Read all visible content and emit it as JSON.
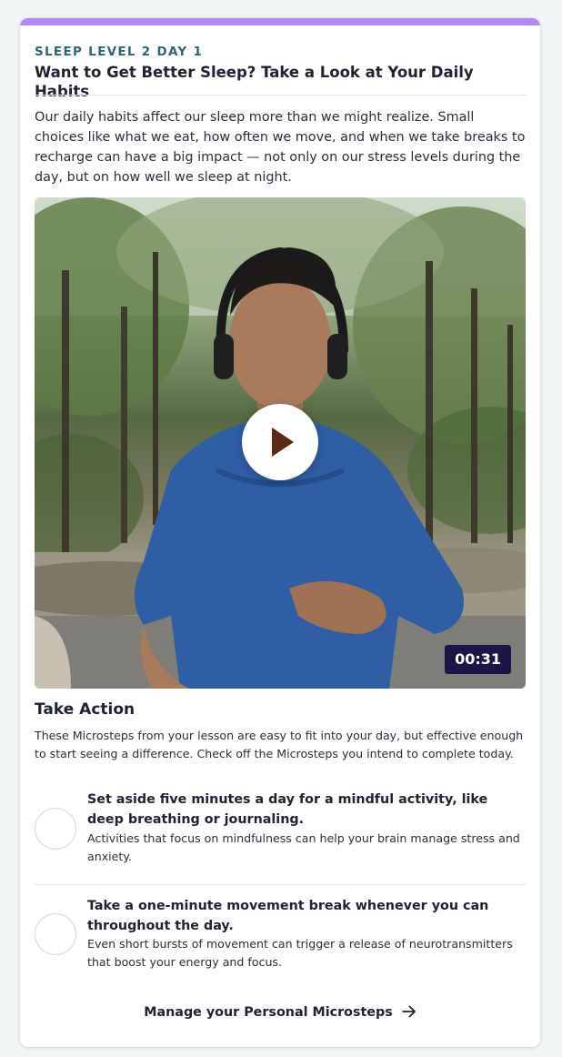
{
  "lesson": {
    "eyebrow": "SLEEP LEVEL 2 DAY 1",
    "title": "Want to Get Better Sleep? Take a Look at Your Daily Habits",
    "intro": "Our daily habits affect our sleep more than we might realize. Small choices like what we eat, how often we move, and when we take breaks to recharge can have a big impact — not only on our stress levels during the day, but on how well we sleep at night."
  },
  "video": {
    "duration": "00:31",
    "play_icon": "play-icon"
  },
  "take_action": {
    "title": "Take Action",
    "description": "These Microsteps from your lesson are easy to fit into your day, but effective enough to start seeing a difference. Check off the Microsteps you intend to complete today.",
    "microsteps": [
      {
        "title": "Set aside five minutes a day for a mindful activity, like deep breathing or journaling.",
        "description": "Activities that focus on mindfulness can help your brain manage stress and anxiety.",
        "checked": false
      },
      {
        "title": "Take a one-minute movement break whenever you can throughout the day.",
        "description": "Even short bursts of movement can trigger a release of neurotransmitters that boost your energy and focus.",
        "checked": false
      }
    ],
    "manage_link": "Manage your Personal Microsteps"
  },
  "colors": {
    "accent_bar": "#b388f0",
    "eyebrow": "#2f6675",
    "duration_badge": "#1e1448",
    "page_bg": "#f1f5f6"
  }
}
